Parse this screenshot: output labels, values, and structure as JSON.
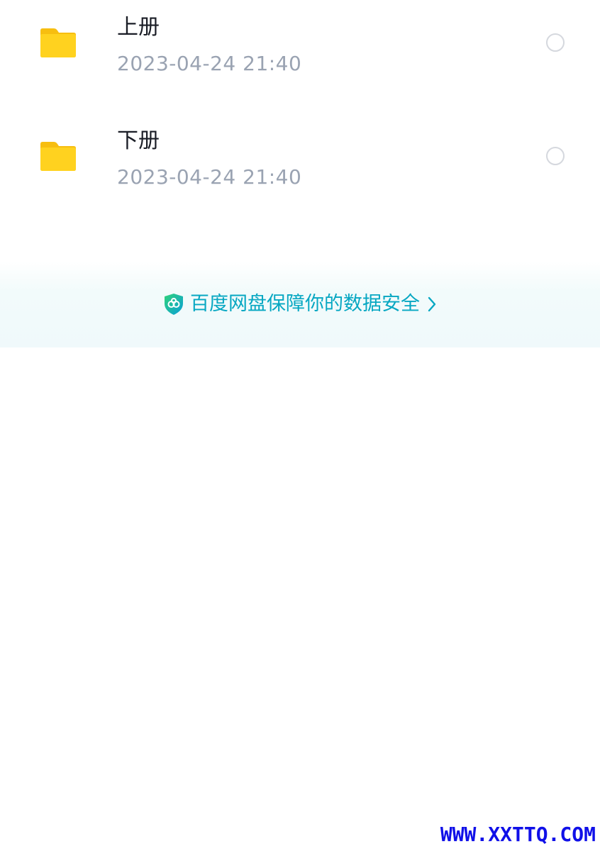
{
  "files": [
    {
      "name": "上册",
      "modified": "2023-04-24  21:40",
      "icon": "folder-icon"
    },
    {
      "name": "下册",
      "modified": "2023-04-24  21:40",
      "icon": "folder-icon"
    }
  ],
  "security_banner": {
    "text": "百度网盘保障你的数据安全",
    "icon": "shield-icon",
    "arrow_icon": "chevron-right-icon"
  },
  "watermark": {
    "text": "WWW.XXTTQ.COM"
  },
  "colors": {
    "folder": "#FFD21F",
    "folder_tab": "#F7BE10",
    "banner_text": "#06A7C2",
    "meta_text": "#9AA3B2",
    "title_text": "#1A1D26",
    "watermark": "#1010E8"
  }
}
